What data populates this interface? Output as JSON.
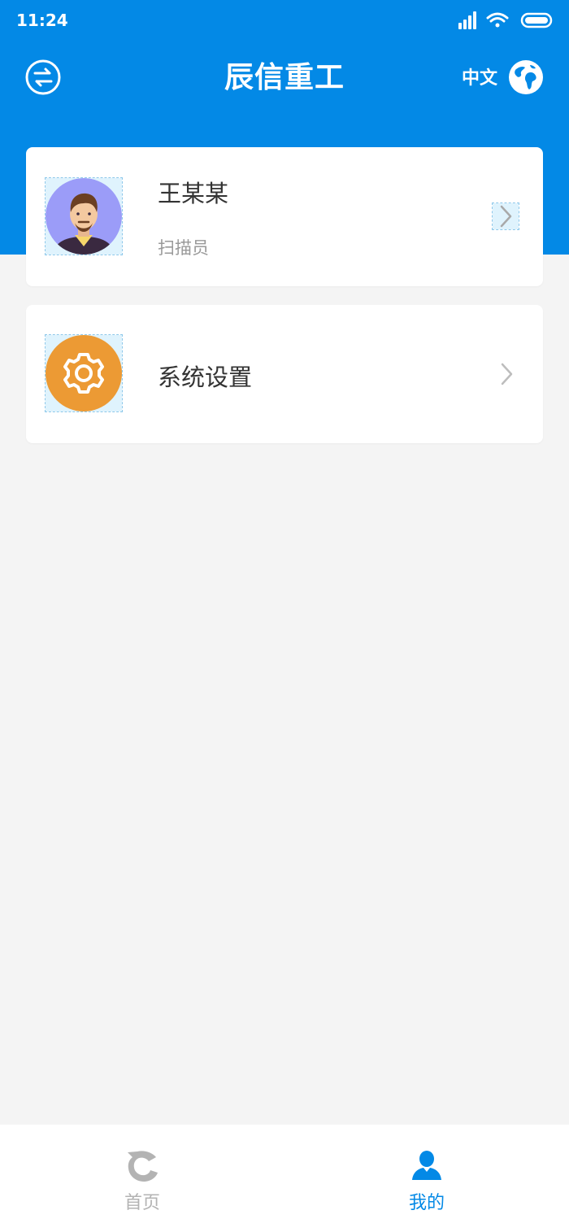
{
  "status_bar": {
    "time": "11:24"
  },
  "header": {
    "title": "辰信重工",
    "language": "中文",
    "left_icon": "swap-icon",
    "right_icon": "globe-icon"
  },
  "profile": {
    "name": "王某某",
    "role": "扫描员",
    "avatar_icon": "user-avatar-icon"
  },
  "settings": {
    "label": "系统设置",
    "icon": "gear-icon"
  },
  "tabbar": {
    "items": [
      {
        "label": "首页",
        "icon": "home-logo-icon",
        "active": false
      },
      {
        "label": "我的",
        "icon": "person-icon",
        "active": true
      }
    ]
  },
  "colors": {
    "primary": "#0389e6",
    "background": "#f4f4f4",
    "settings_icon_bg": "#ec9a34",
    "avatar_bg": "#9b9cf8",
    "tab_inactive": "#b3b3b3"
  }
}
